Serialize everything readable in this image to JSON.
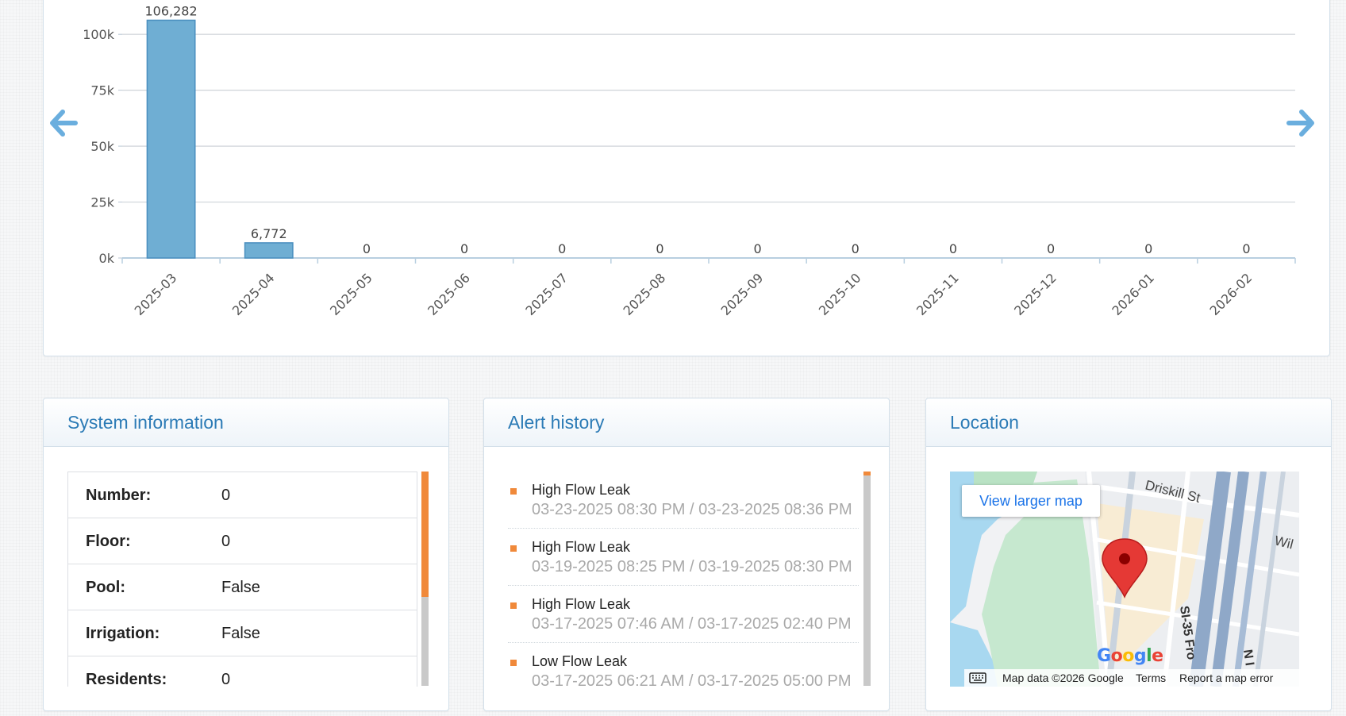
{
  "chart_data": {
    "type": "bar",
    "categories": [
      "2025-03",
      "2025-04",
      "2025-05",
      "2025-06",
      "2025-07",
      "2025-08",
      "2025-09",
      "2025-10",
      "2025-11",
      "2025-12",
      "2026-01",
      "2026-02"
    ],
    "values": [
      106282,
      6772,
      0,
      0,
      0,
      0,
      0,
      0,
      0,
      0,
      0,
      0
    ],
    "data_labels": [
      "106,282",
      "6,772",
      "0",
      "0",
      "0",
      "0",
      "0",
      "0",
      "0",
      "0",
      "0",
      "0"
    ],
    "y_ticks": [
      0,
      25000,
      50000,
      75000,
      100000
    ],
    "y_tick_labels": [
      "0k",
      "25k",
      "50k",
      "75k",
      "100k"
    ],
    "ylim": [
      0,
      110000
    ],
    "grid": true,
    "bar_color": "#6faed3",
    "title": "",
    "xlabel": "",
    "ylabel": ""
  },
  "nav": {
    "prev_icon": "arrow-left-icon",
    "next_icon": "arrow-right-icon",
    "color": "#6aaede"
  },
  "system_info": {
    "title": "System information",
    "rows": [
      {
        "label": "Number:",
        "value": "0"
      },
      {
        "label": "Floor:",
        "value": "0"
      },
      {
        "label": "Pool:",
        "value": "False"
      },
      {
        "label": "Irrigation:",
        "value": "False"
      },
      {
        "label": "Residents:",
        "value": "0"
      }
    ]
  },
  "alert_history": {
    "title": "Alert history",
    "items": [
      {
        "name": "High Flow Leak",
        "time": "03-23-2025 08:30 PM / 03-23-2025 08:36 PM"
      },
      {
        "name": "High Flow Leak",
        "time": "03-19-2025 08:25 PM / 03-19-2025 08:30 PM"
      },
      {
        "name": "High Flow Leak",
        "time": "03-17-2025 07:46 AM / 03-17-2025 02:40 PM"
      },
      {
        "name": "Low Flow Leak",
        "time": "03-17-2025 06:21 AM / 03-17-2025 05:00 PM"
      }
    ]
  },
  "location": {
    "title": "Location",
    "view_larger": "View larger map",
    "map_data": "Map data ©2026 Google",
    "terms": "Terms",
    "report": "Report a map error",
    "google": [
      "G",
      "o",
      "o",
      "g",
      "l",
      "e"
    ],
    "street_labels": [
      "Driskill St",
      "Wil",
      "SI-35 Fro",
      "N I"
    ]
  },
  "colors": {
    "accent": "#2c7bb6",
    "scroll_thumb": "#f0893a",
    "pin": "#e53935"
  }
}
